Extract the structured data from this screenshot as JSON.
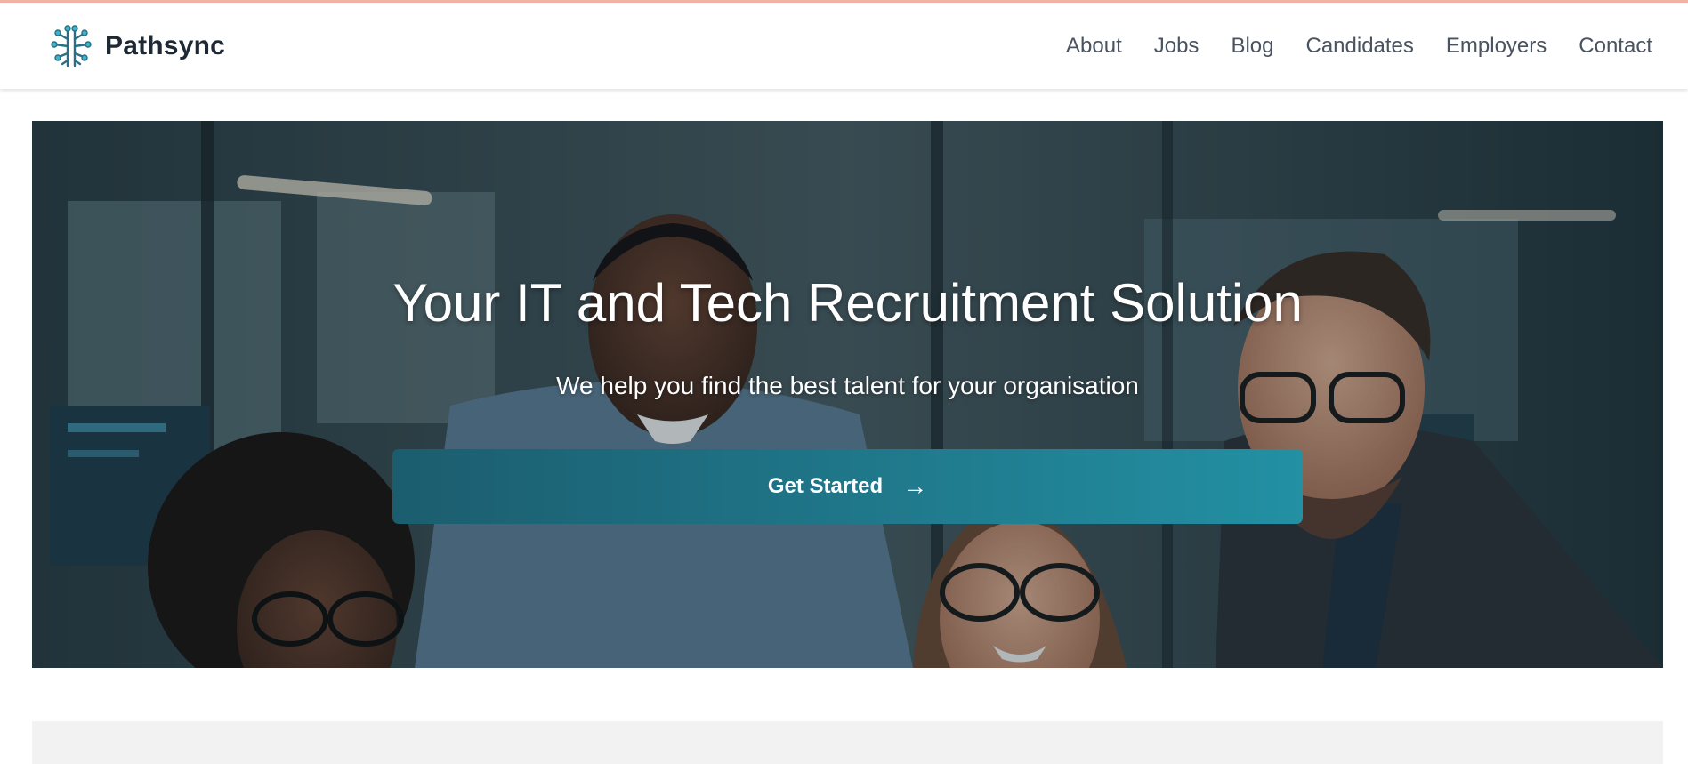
{
  "brand": {
    "name": "Pathsync",
    "logo_icon": "circuit-tree-icon",
    "accent": "#2b8fa8"
  },
  "nav": {
    "items": [
      {
        "label": "About"
      },
      {
        "label": "Jobs"
      },
      {
        "label": "Blog"
      },
      {
        "label": "Candidates"
      },
      {
        "label": "Employers"
      },
      {
        "label": "Contact"
      }
    ]
  },
  "hero": {
    "title": "Your IT and Tech Recruitment Solution",
    "subtitle": "We help you find the best talent for your organisation",
    "cta_label": "Get Started",
    "cta_arrow": "→",
    "image": "team-photo-office"
  },
  "colors": {
    "top_accent": "#f3b3a4",
    "cta_start": "#1b5d6f",
    "cta_end": "#2390a3"
  }
}
